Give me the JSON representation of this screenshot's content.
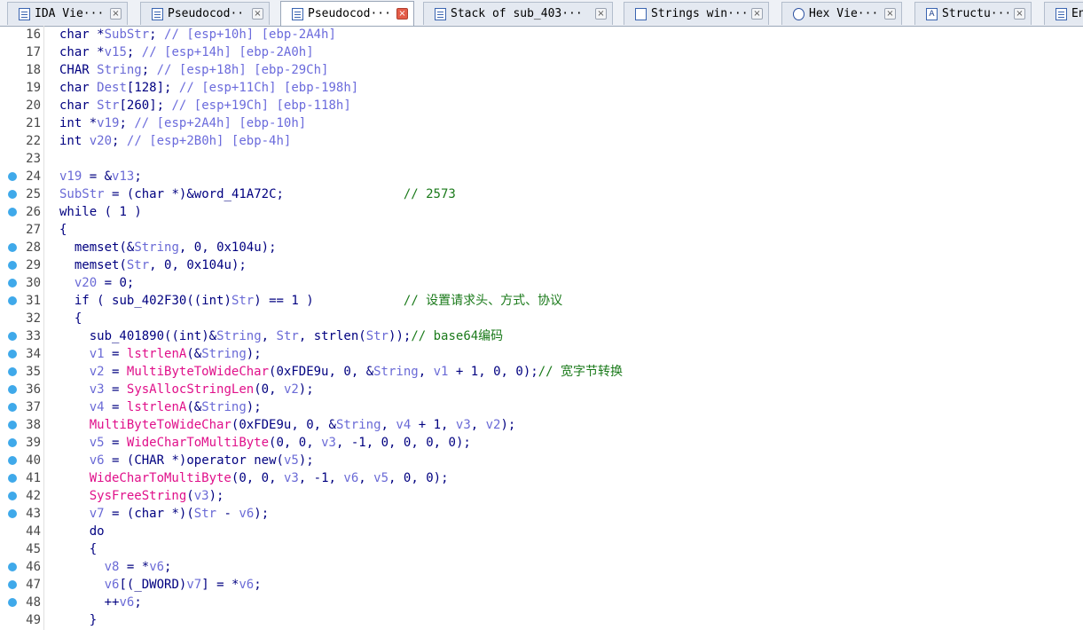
{
  "tabs": [
    {
      "label": "IDA Vie···",
      "icon": "ida-view-icon",
      "active": false
    },
    {
      "label": "Pseudocod···",
      "icon": "pseudocode-icon",
      "active": false
    },
    {
      "label": "Pseudocod···",
      "icon": "pseudocode-icon",
      "active": true
    },
    {
      "label": "Stack of sub_403···",
      "icon": "stack-icon",
      "active": false
    },
    {
      "label": "Strings win···",
      "icon": "strings-icon",
      "active": false
    },
    {
      "label": "Hex Vie···",
      "icon": "hex-view-icon",
      "active": false
    },
    {
      "label": "Structu···",
      "icon": "structures-icon",
      "active": false
    },
    {
      "label": "En",
      "icon": "enums-icon",
      "active": false
    }
  ],
  "colors": {
    "breakpoint_dot": "#3fa9ea",
    "active_close": "#e45c48"
  },
  "code": {
    "lines": [
      {
        "n": "16",
        "dot": false,
        "t": "char *SubStr; // [esp+10h] [ebp-2A4h]"
      },
      {
        "n": "17",
        "dot": false,
        "t": "char *v15; // [esp+14h] [ebp-2A0h]"
      },
      {
        "n": "18",
        "dot": false,
        "t": "CHAR String; // [esp+18h] [ebp-29Ch]"
      },
      {
        "n": "19",
        "dot": false,
        "t": "char Dest[128]; // [esp+11Ch] [ebp-198h]"
      },
      {
        "n": "20",
        "dot": false,
        "t": "char Str[260]; // [esp+19Ch] [ebp-118h]"
      },
      {
        "n": "21",
        "dot": false,
        "t": "int *v19; // [esp+2A4h] [ebp-10h]"
      },
      {
        "n": "22",
        "dot": false,
        "t": "int v20; // [esp+2B0h] [ebp-4h]"
      },
      {
        "n": "23",
        "dot": false,
        "t": ""
      },
      {
        "n": "24",
        "dot": true,
        "t": "v19 = &v13;"
      },
      {
        "n": "25",
        "dot": true,
        "t": "SubStr = (char *)&word_41A72C;                // 2573"
      },
      {
        "n": "26",
        "dot": true,
        "t": "while ( 1 )"
      },
      {
        "n": "27",
        "dot": false,
        "t": "{"
      },
      {
        "n": "28",
        "dot": true,
        "t": "  memset(&String, 0, 0x104u);"
      },
      {
        "n": "29",
        "dot": true,
        "t": "  memset(Str, 0, 0x104u);"
      },
      {
        "n": "30",
        "dot": true,
        "t": "  v20 = 0;"
      },
      {
        "n": "31",
        "dot": true,
        "t": "  if ( sub_402F30((int)Str) == 1 )            // 设置请求头、方式、协议"
      },
      {
        "n": "32",
        "dot": false,
        "t": "  {"
      },
      {
        "n": "33",
        "dot": true,
        "t": "    sub_401890((int)&String, Str, strlen(Str));// base64编码"
      },
      {
        "n": "34",
        "dot": true,
        "t": "    v1 = lstrlenA(&String);"
      },
      {
        "n": "35",
        "dot": true,
        "t": "    v2 = MultiByteToWideChar(0xFDE9u, 0, &String, v1 + 1, 0, 0);// 宽字节转换"
      },
      {
        "n": "36",
        "dot": true,
        "t": "    v3 = SysAllocStringLen(0, v2);"
      },
      {
        "n": "37",
        "dot": true,
        "t": "    v4 = lstrlenA(&String);"
      },
      {
        "n": "38",
        "dot": true,
        "t": "    MultiByteToWideChar(0xFDE9u, 0, &String, v4 + 1, v3, v2);"
      },
      {
        "n": "39",
        "dot": true,
        "t": "    v5 = WideCharToMultiByte(0, 0, v3, -1, 0, 0, 0, 0);"
      },
      {
        "n": "40",
        "dot": true,
        "t": "    v6 = (CHAR *)operator new(v5);"
      },
      {
        "n": "41",
        "dot": true,
        "t": "    WideCharToMultiByte(0, 0, v3, -1, v6, v5, 0, 0);"
      },
      {
        "n": "42",
        "dot": true,
        "t": "    SysFreeString(v3);"
      },
      {
        "n": "43",
        "dot": true,
        "t": "    v7 = (char *)(Str - v6);"
      },
      {
        "n": "44",
        "dot": false,
        "t": "    do"
      },
      {
        "n": "45",
        "dot": false,
        "t": "    {"
      },
      {
        "n": "46",
        "dot": true,
        "t": "      v8 = *v6;"
      },
      {
        "n": "47",
        "dot": true,
        "t": "      v6[(_DWORD)v7] = *v6;"
      },
      {
        "n": "48",
        "dot": true,
        "t": "      ++v6;"
      },
      {
        "n": "49",
        "dot": false,
        "t": "    }"
      }
    ]
  }
}
